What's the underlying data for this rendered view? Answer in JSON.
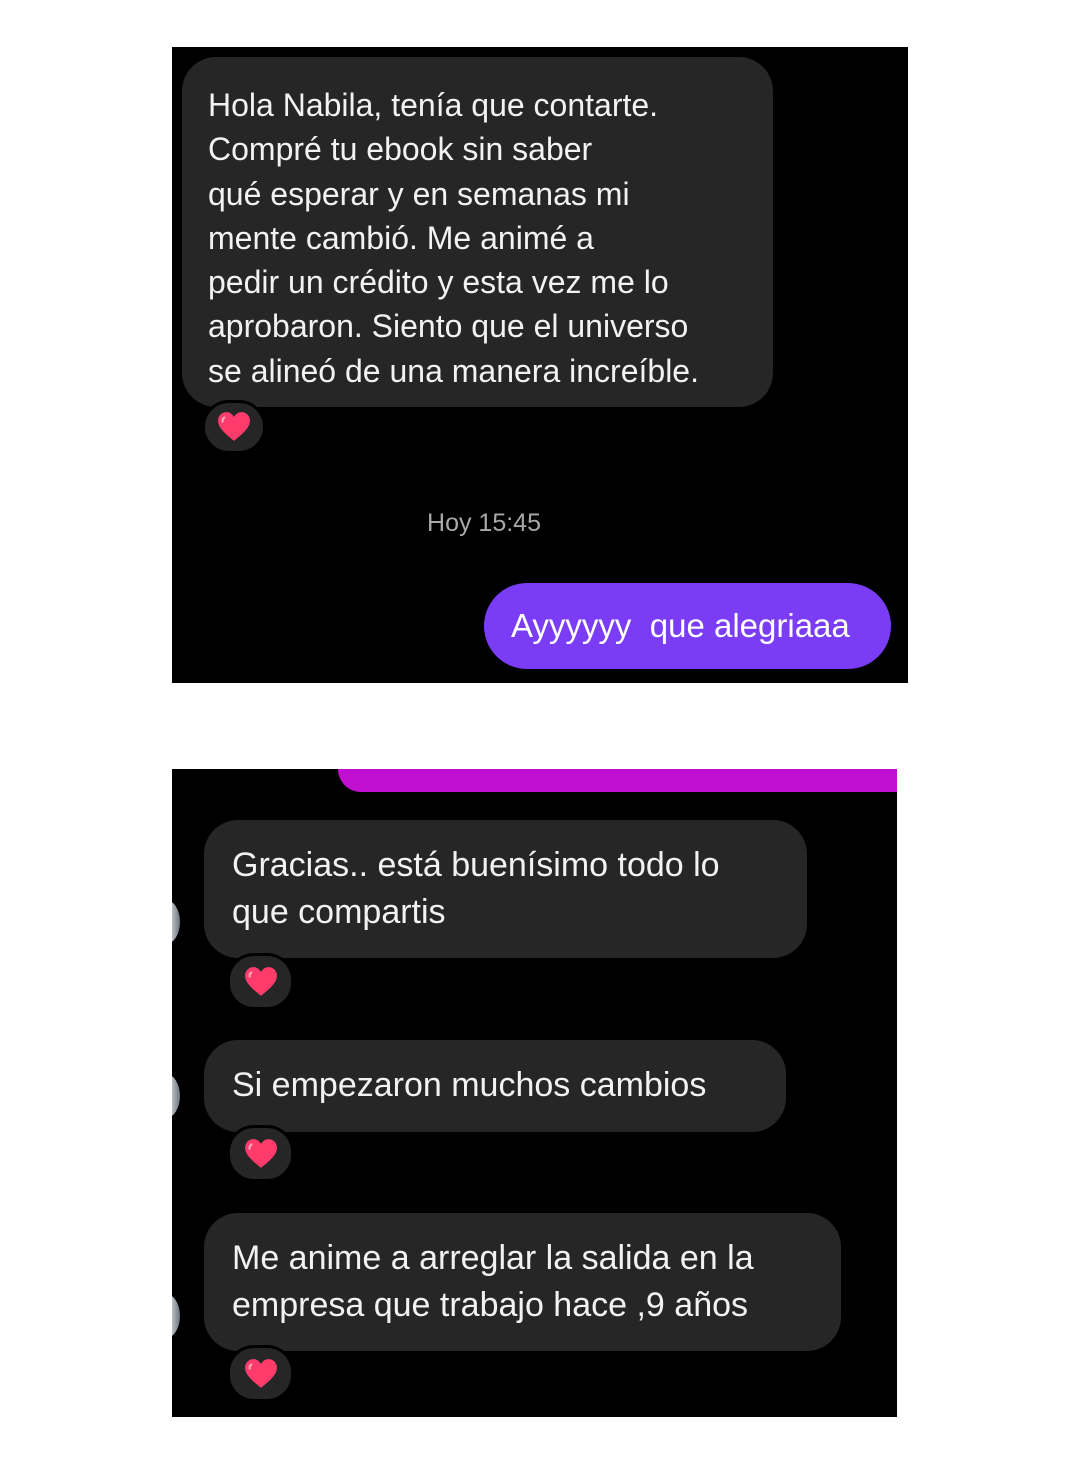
{
  "colors": {
    "panel_background": "#000000",
    "incoming_bubble": "#262626",
    "outgoing_bubble": "#7a3df5",
    "timestamp_text": "#a8a8a8",
    "accent_strip": "#c10fd0",
    "heart": "#ff3b6b"
  },
  "conversation_top": {
    "incoming_message": "Hola Nabila, tenía que contarte.\nCompré tu ebook sin saber\nqué esperar y en semanas mi\nmente cambió. Me animé a\npedir un crédito y esta vez me lo\naprobaron. Siento que el universo\nse alineó de una manera increíble.",
    "reaction_icon": "heart-icon",
    "timestamp": "Hoy 15:45",
    "outgoing_message": "Ayyyyyy  que alegriaaa"
  },
  "conversation_bottom": {
    "messages": [
      {
        "text": "Gracias.. está buenísimo todo lo\nque compartis",
        "reaction_icon": "heart-icon"
      },
      {
        "text": "Si empezaron muchos cambios",
        "reaction_icon": "heart-icon"
      },
      {
        "text": "Me anime a arreglar la salida en la\nempresa que trabajo hace ,9 años",
        "reaction_icon": "heart-icon"
      }
    ]
  }
}
